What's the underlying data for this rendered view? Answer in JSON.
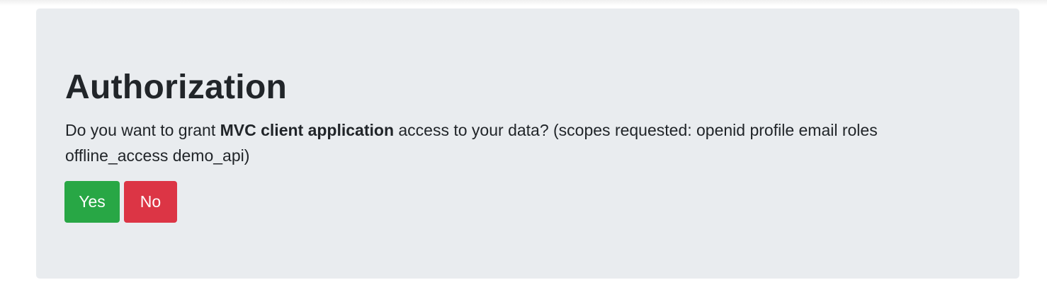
{
  "consent": {
    "title": "Authorization",
    "prompt_before": "Do you want to grant ",
    "client_name": "MVC client application",
    "prompt_after": " access to your data? (scopes requested: openid profile email roles offline_access demo_api)",
    "yes_label": "Yes",
    "no_label": "No"
  },
  "colors": {
    "panel_background": "#e9ecef",
    "yes_button": "#28a745",
    "no_button": "#dc3545",
    "text": "#212529"
  }
}
